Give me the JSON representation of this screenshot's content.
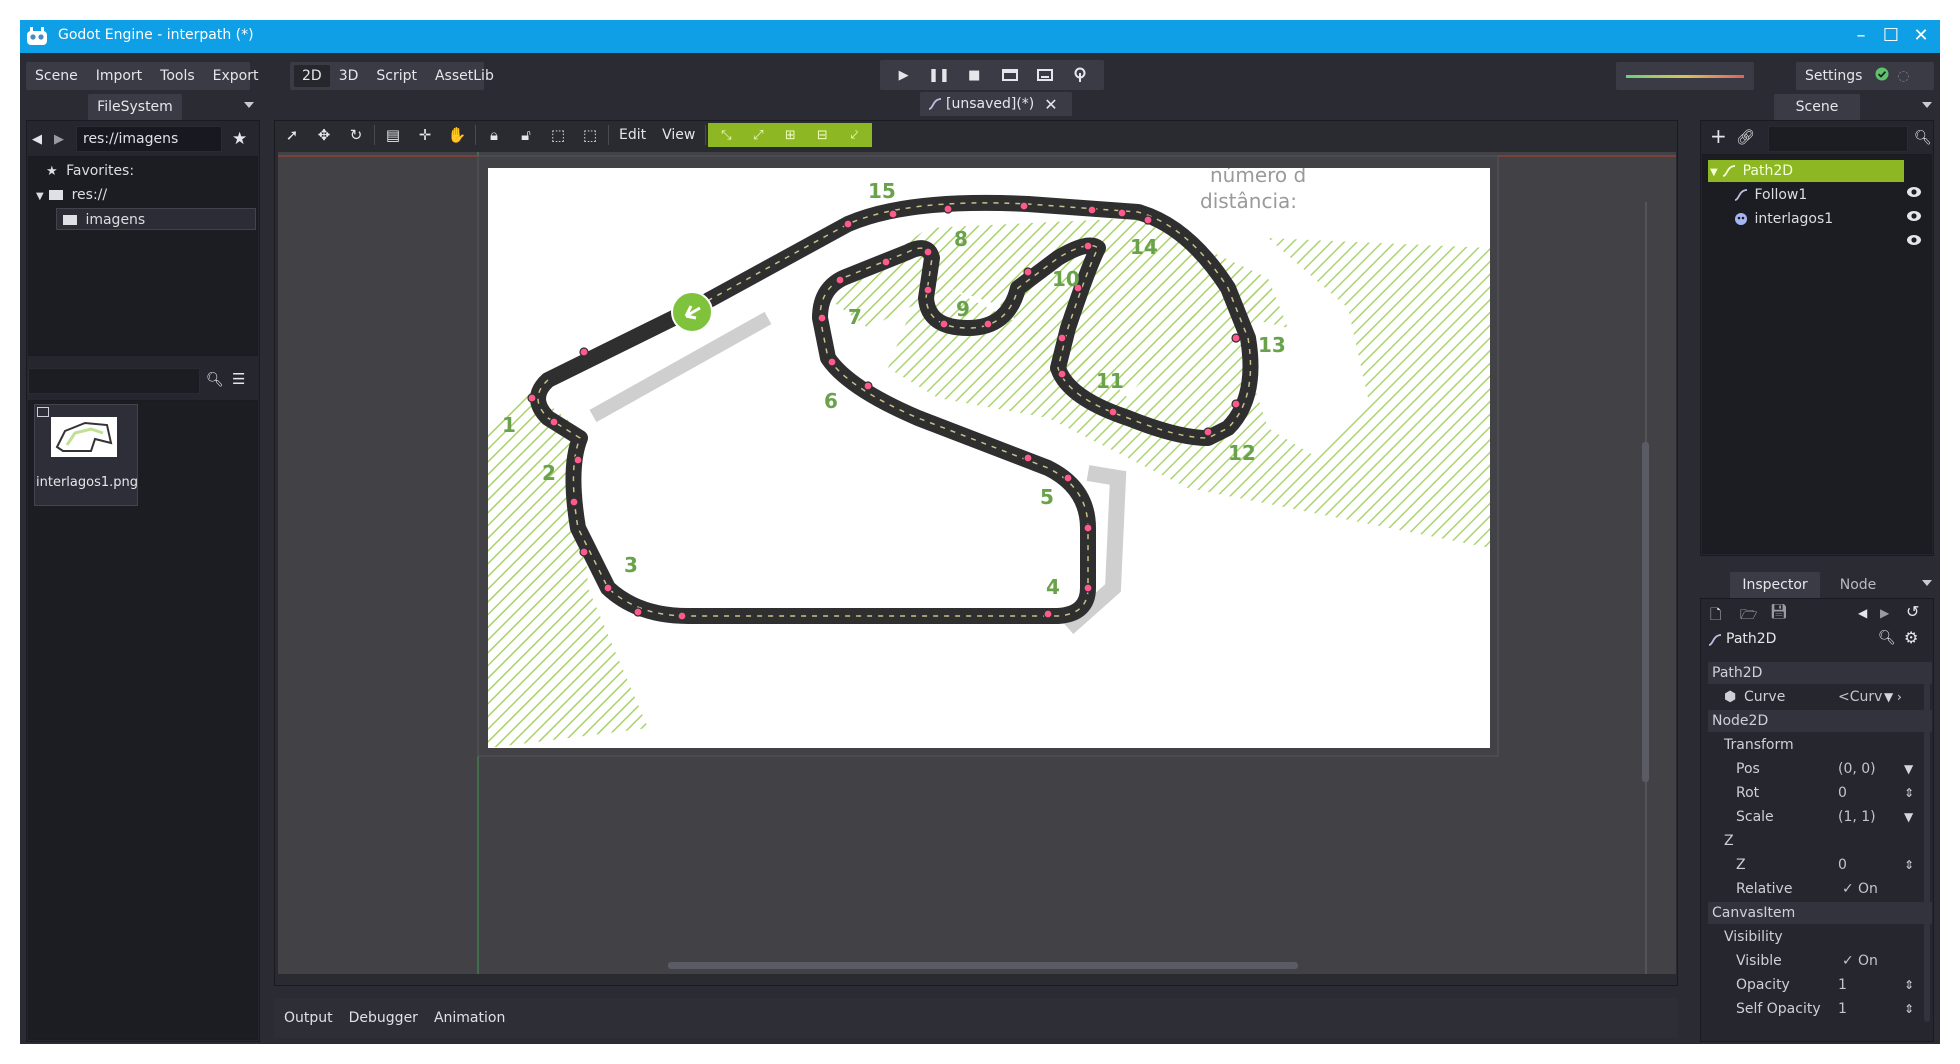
{
  "window": {
    "title": "Godot Engine - interpath (*)"
  },
  "menu": {
    "items": [
      "Scene",
      "Import",
      "Tools",
      "Export"
    ]
  },
  "modes": {
    "items": [
      "2D",
      "3D",
      "Script",
      "AssetLib"
    ],
    "active": "2D"
  },
  "settings_label": "Settings",
  "editor_tab": {
    "label": "[unsaved](*)"
  },
  "filesystem": {
    "tab_label": "FileSystem",
    "path_value": "res://imagens",
    "favorites_label": "Favorites:",
    "root_label": "res://",
    "folder_label": "imagens",
    "search_value": "",
    "file_name": "interlagos1.png"
  },
  "toolbar2d": {
    "edit_label": "Edit",
    "view_label": "View"
  },
  "track_labels": [
    "1",
    "2",
    "3",
    "4",
    "5",
    "6",
    "7",
    "8",
    "9",
    "10",
    "11",
    "12",
    "13",
    "14",
    "15"
  ],
  "image_text": {
    "line1": "número d",
    "line2": "distância:"
  },
  "scene_panel": {
    "tab_label": "Scene",
    "filter_value": "",
    "nodes": [
      "Path2D",
      "Follow1",
      "interlagos1"
    ]
  },
  "inspector": {
    "tabs": [
      "Inspector",
      "Node"
    ],
    "object_label": "Path2D",
    "rows": {
      "path2d_section": "Path2D",
      "curve_label": "Curve",
      "curve_value": "<Curv",
      "node2d_section": "Node2D",
      "transform_label": "Transform",
      "pos_label": "Pos",
      "pos_value": "(0, 0)",
      "rot_label": "Rot",
      "rot_value": "0",
      "scale_label": "Scale",
      "scale_value": "(1, 1)",
      "z_group_label": "Z",
      "z_label": "Z",
      "z_value": "0",
      "relative_label": "Relative",
      "relative_value": "On",
      "canvasitem_section": "CanvasItem",
      "visibility_label": "Visibility",
      "visible_label": "Visible",
      "visible_value": "On",
      "opacity_label": "Opacity",
      "opacity_value": "1",
      "self_opacity_label": "Self Opacity",
      "self_opacity_value": "1"
    }
  },
  "bottom_tabs": [
    "Output",
    "Debugger",
    "Animation"
  ],
  "colors": {
    "titlebar": "#0e9fe6",
    "path_accent": "#8db823",
    "editor_bg": "#2b2b33",
    "point": "#ff5a8c"
  }
}
